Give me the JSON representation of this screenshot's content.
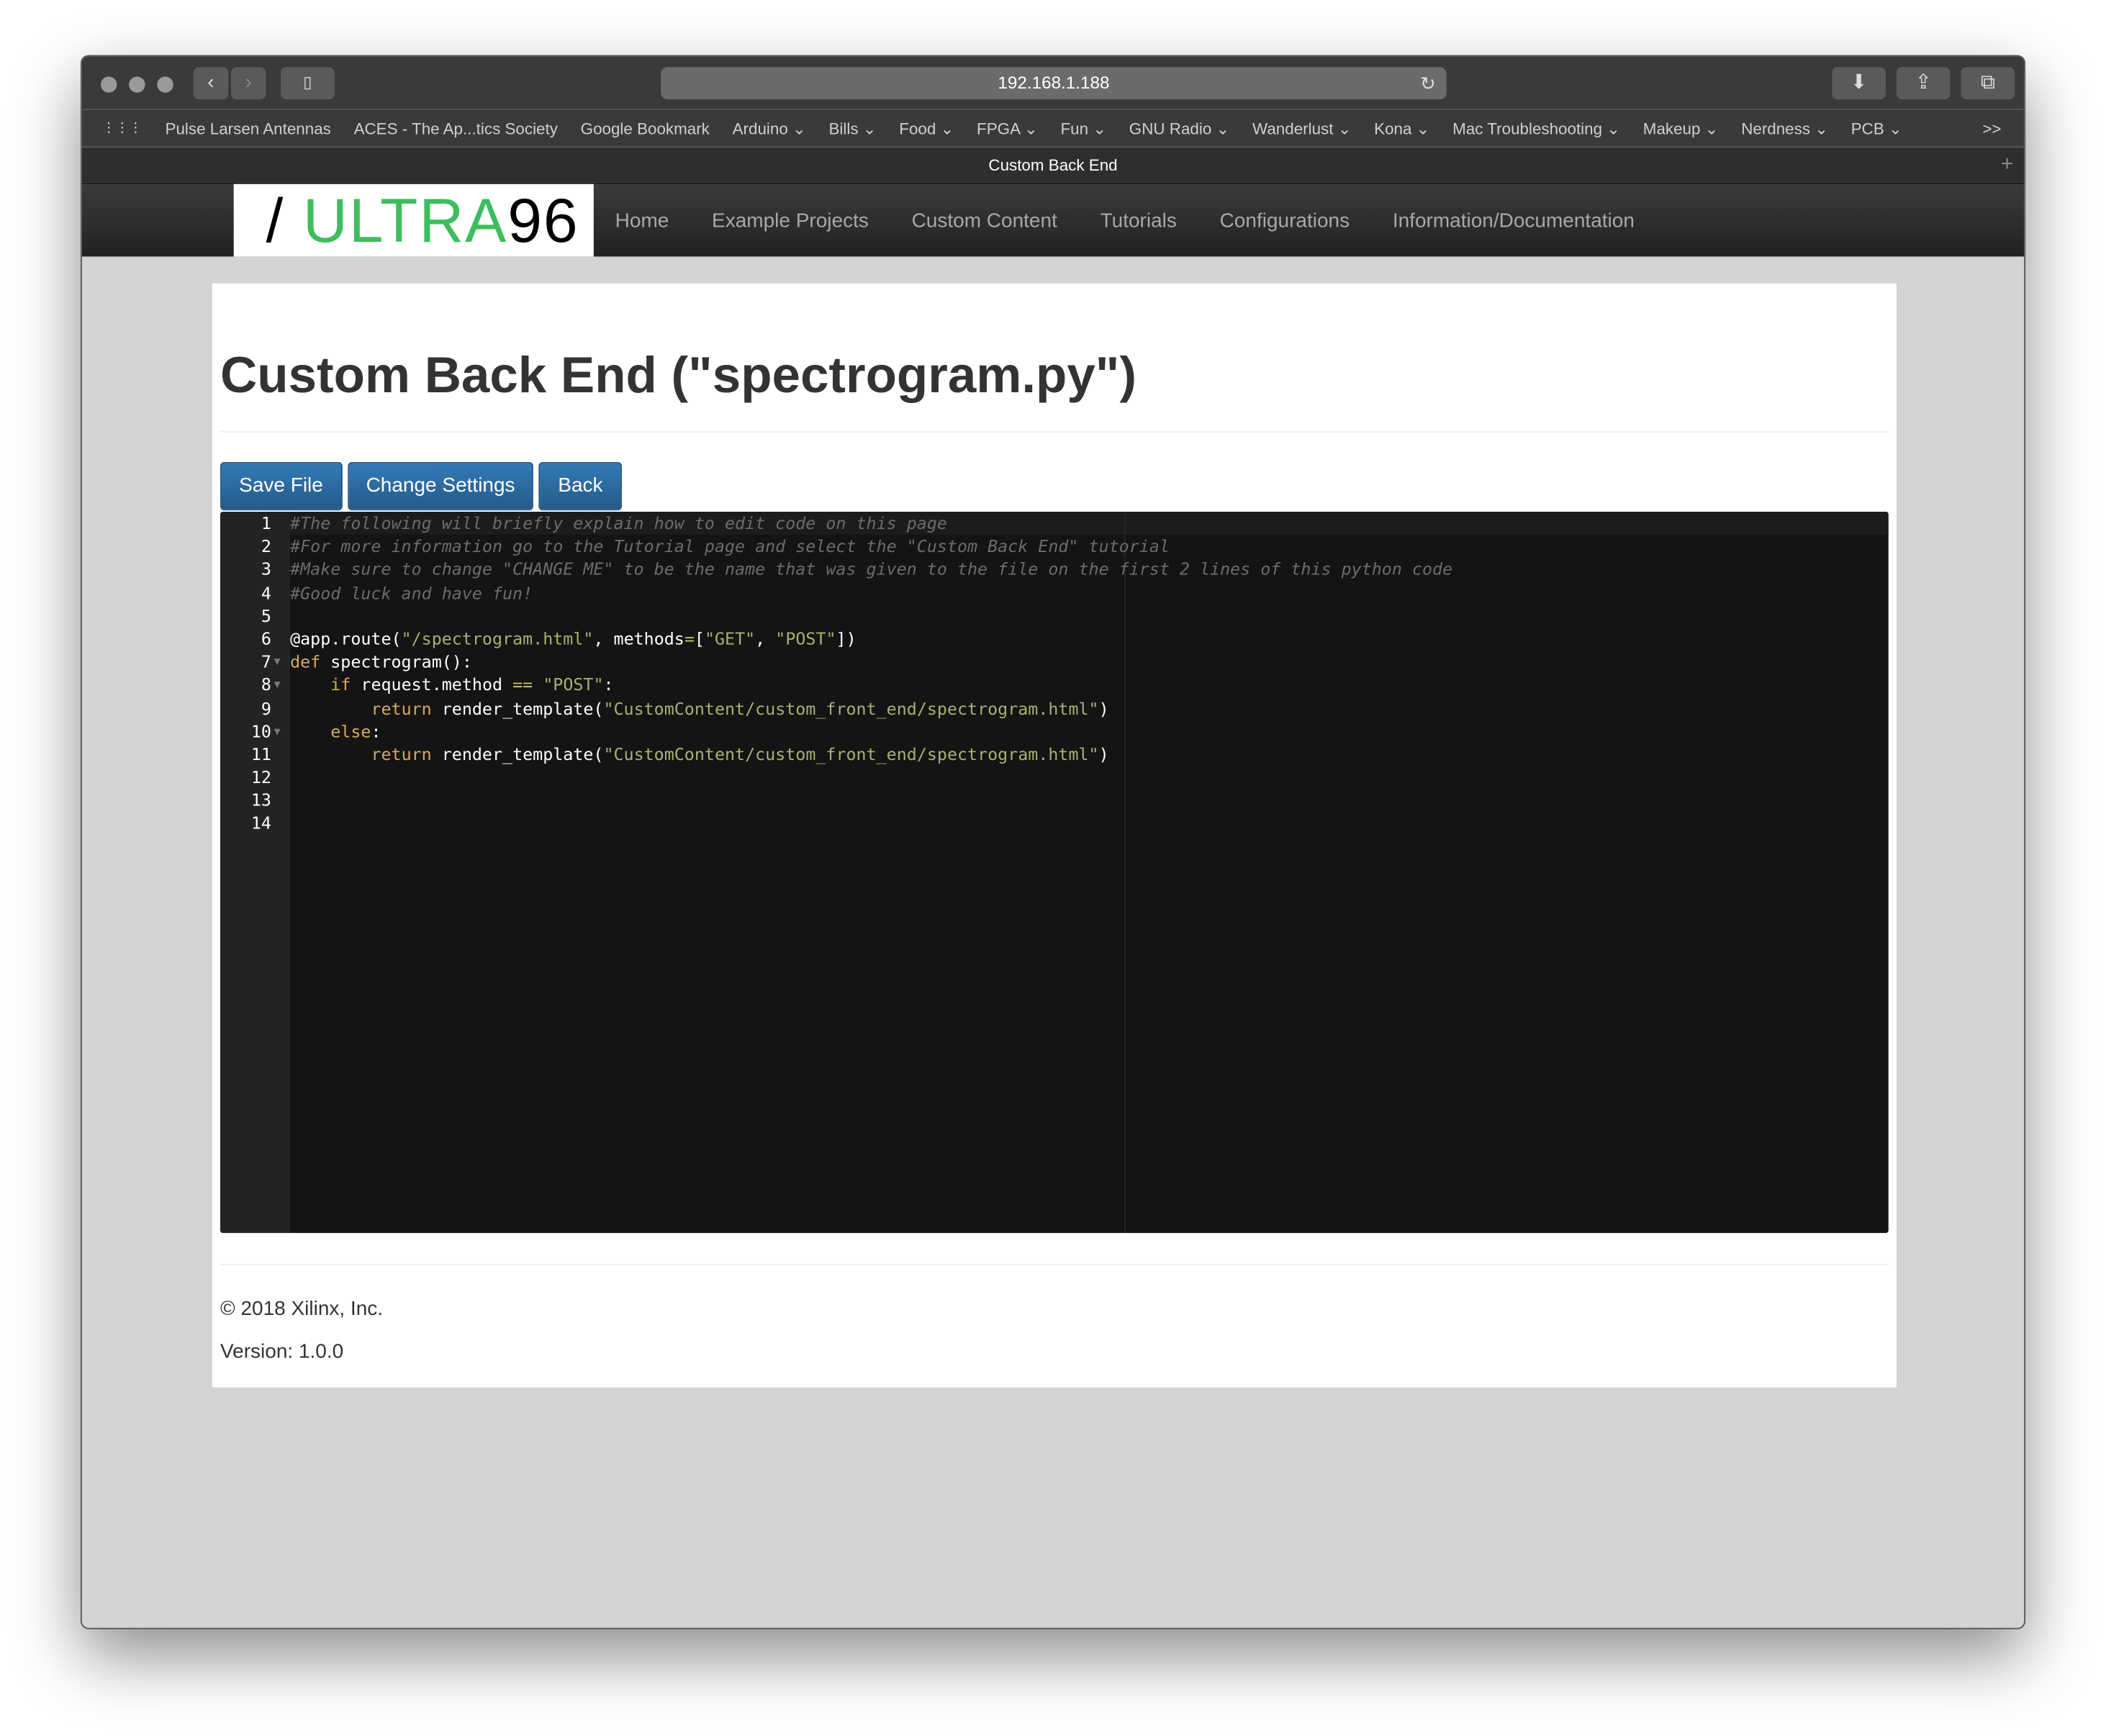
{
  "browser": {
    "url": "192.168.1.188",
    "tab_title": "Custom Back End",
    "bookmarks": [
      "Pulse Larsen Antennas",
      "ACES - The Ap...tics Society",
      "Google Bookmark",
      "Arduino ⌄",
      "Bills ⌄",
      "Food ⌄",
      "FPGA ⌄",
      "Fun ⌄",
      "GNU Radio ⌄",
      "Wanderlust ⌄",
      "Kona ⌄",
      "Mac Troubleshooting ⌄",
      "Makeup ⌄",
      "Nerdness ⌄",
      "PCB ⌄"
    ],
    "overflow": ">>"
  },
  "site": {
    "logo": {
      "slash": "/ ",
      "ultra": "ULTRA",
      "num": "96"
    },
    "nav": [
      "Home",
      "Example Projects",
      "Custom Content",
      "Tutorials",
      "Configurations",
      "Information/Documentation"
    ]
  },
  "page": {
    "title": "Custom Back End (\"spectrogram.py\")",
    "buttons": {
      "save": "Save File",
      "settings": "Change Settings",
      "back": "Back"
    },
    "code": [
      [
        [
          "comment",
          "#The following will briefly explain how to edit code on this page"
        ]
      ],
      [
        [
          "comment",
          "#For more information go to the Tutorial page and select the \"Custom Back End\" tutorial"
        ]
      ],
      [
        [
          "comment",
          "#Make sure to change \"CHANGE ME\" to be the name that was given to the file on the first 2 lines of this python code"
        ]
      ],
      [
        [
          "comment",
          "#Good luck and have fun!"
        ]
      ],
      [],
      [
        [
          "plain",
          "@app.route("
        ],
        [
          "string",
          "\"/spectrogram.html\""
        ],
        [
          "plain",
          ", methods"
        ],
        [
          "op",
          "="
        ],
        [
          "plain",
          "["
        ],
        [
          "string",
          "\"GET\""
        ],
        [
          "plain",
          ", "
        ],
        [
          "string",
          "\"POST\""
        ],
        [
          "plain",
          "])"
        ]
      ],
      [
        [
          "kw",
          "def"
        ],
        [
          "plain",
          " spectrogram():"
        ]
      ],
      [
        [
          "plain",
          "    "
        ],
        [
          "kw",
          "if"
        ],
        [
          "plain",
          " request.method "
        ],
        [
          "op",
          "=="
        ],
        [
          "plain",
          " "
        ],
        [
          "string",
          "\"POST\""
        ],
        [
          "plain",
          ":"
        ]
      ],
      [
        [
          "plain",
          "        "
        ],
        [
          "kw",
          "return"
        ],
        [
          "plain",
          " render_template("
        ],
        [
          "string",
          "\"CustomContent/custom_front_end/spectrogram.html\""
        ],
        [
          "plain",
          ")"
        ]
      ],
      [
        [
          "plain",
          "    "
        ],
        [
          "kw",
          "else"
        ],
        [
          "plain",
          ":"
        ]
      ],
      [
        [
          "plain",
          "        "
        ],
        [
          "kw",
          "return"
        ],
        [
          "plain",
          " render_template("
        ],
        [
          "string",
          "\"CustomContent/custom_front_end/spectrogram.html\""
        ],
        [
          "plain",
          ")"
        ]
      ],
      [],
      [],
      []
    ],
    "folds": [
      7,
      8,
      10
    ],
    "footer": {
      "copyright": "© 2018 Xilinx, Inc.",
      "version": "Version: 1.0.0"
    }
  }
}
